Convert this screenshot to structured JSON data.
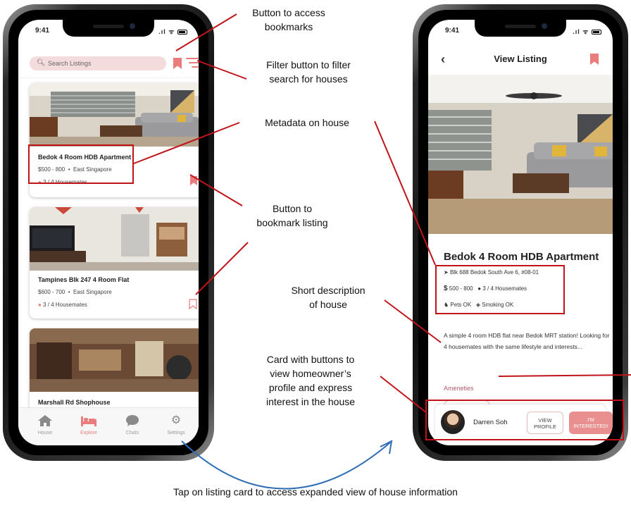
{
  "left_phone": {
    "status_time": "9:41",
    "search_placeholder": "Search Listings",
    "listings": [
      {
        "title": "Bedok 4 Room HDB Apartment",
        "price": "$500 - 800",
        "region": "East Singapore",
        "housemates": "3 / 4 Housemates",
        "bookmarked": true
      },
      {
        "title": "Tampines Blk 247 4 Room Flat",
        "price": "$600 - 700",
        "region": "East Singapore",
        "housemates": "3 / 4 Housemates",
        "bookmarked": false
      },
      {
        "title": "Marshall Rd Shophouse"
      }
    ],
    "tabs": [
      {
        "label": "House",
        "icon": "home-icon",
        "active": false
      },
      {
        "label": "Explore",
        "icon": "bed-icon",
        "active": true
      },
      {
        "label": "Chats",
        "icon": "chat-bubble-icon",
        "active": false
      },
      {
        "label": "Settings",
        "icon": "gear-icon",
        "active": false
      }
    ]
  },
  "right_phone": {
    "status_time": "9:41",
    "header_title": "View Listing",
    "listing_title": "Bedok 4 Room HDB Apartment",
    "address": "Blk 688 Bedok South Ave 6, #08-01",
    "price": "500 - 800",
    "housemates": "3 / 4 Housemates",
    "pets": "Pets OK",
    "smoking": "Smoking OK",
    "description": "A simple 4 room HDB flat near Bedok MRT station! Looking for 4 housemates with the same lifestyle and interests...",
    "amenities_label": "Ameneties",
    "owner_name": "Darren Soh",
    "view_profile_line1": "VIEW",
    "view_profile_line2": "PROFILE",
    "interested_line1": "I'M",
    "interested_line2": "INTERESTED!"
  },
  "annotations": {
    "bookmarks_button_l1": "Button to access",
    "bookmarks_button_l2": "bookmarks",
    "filter_button_l1": "Filter button to filter",
    "filter_button_l2": "search for houses",
    "metadata": "Metadata on house",
    "bookmark_listing_l1": "Button to",
    "bookmark_listing_l2": "bookmark listing",
    "short_desc_l1": "Short description",
    "short_desc_l2": "of house",
    "card_l1": "Card with buttons to",
    "card_l2": "view homeowner’s",
    "card_l3": "profile and express",
    "card_l4": "interest in the house",
    "caption": "Tap on listing card to access expanded view of house information"
  },
  "colors": {
    "accent": "#e97d7d",
    "annotation_red": "#c0141a",
    "arrow_blue": "#2f6db5"
  }
}
